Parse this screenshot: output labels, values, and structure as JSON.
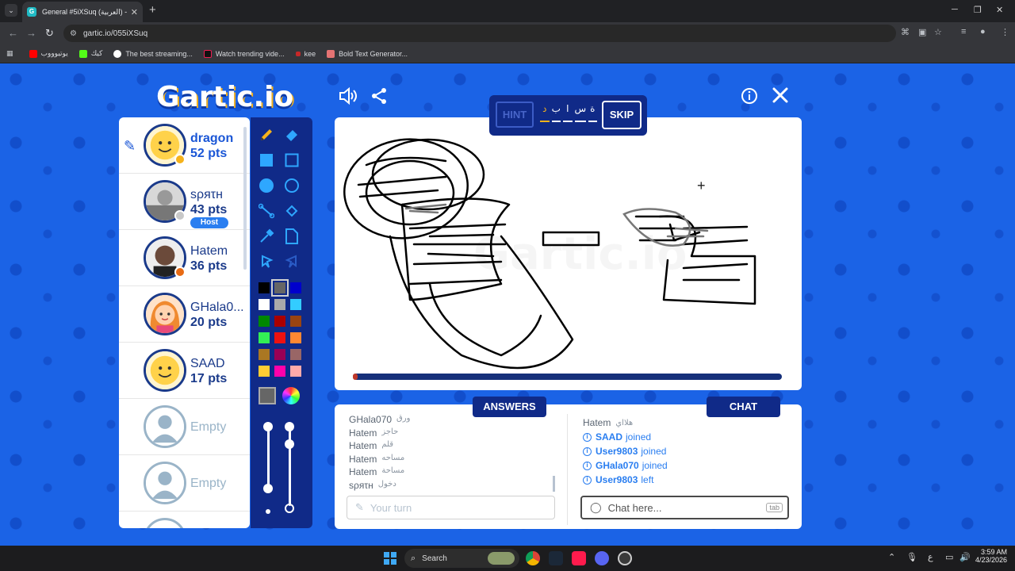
{
  "browser": {
    "tab_title": "General #5iXSuq (العربية) - Gartic",
    "url": "gartic.io/055iXSuq",
    "bookmarks": [
      "يوتيوووب",
      "كيك",
      "The best streaming...",
      "Watch trending vide...",
      "kee",
      "Bold Text Generator..."
    ]
  },
  "game": {
    "logo": "Gartic.io",
    "players": [
      {
        "name": "dragon",
        "pts": "52 pts",
        "badge": "",
        "status_color": "#f5b21b"
      },
      {
        "name": "ѕρяτн",
        "pts": "43 pts",
        "badge": "Host",
        "status_color": "#c8c8c8"
      },
      {
        "name": "Hatem",
        "pts": "36 pts",
        "badge": "",
        "status_color": "#e86b14"
      },
      {
        "name": "GHala0...",
        "pts": "20 pts",
        "badge": "",
        "status_color": ""
      },
      {
        "name": "SAAD",
        "pts": "17 pts",
        "badge": "",
        "status_color": ""
      },
      {
        "name": "Empty",
        "pts": "",
        "badge": "",
        "status_color": ""
      },
      {
        "name": "Empty",
        "pts": "",
        "badge": "",
        "status_color": ""
      }
    ],
    "hint_label": "HINT",
    "skip_label": "SKIP",
    "word_letters": [
      "د",
      "ب",
      "ا",
      "س",
      "ة"
    ],
    "round_progress": 0.01,
    "answers_tab": "ANSWERS",
    "chat_tab": "CHAT",
    "answers": [
      {
        "user": "GHala070",
        "word": "ورق"
      },
      {
        "user": "Hatem",
        "word": "حاجز"
      },
      {
        "user": "Hatem",
        "word": "قلم"
      },
      {
        "user": "Hatem",
        "word": "مساحه"
      },
      {
        "user": "Hatem",
        "word": "مساحة"
      },
      {
        "user": "ѕρяτн",
        "word": "دخول"
      }
    ],
    "chat": [
      {
        "type": "msg",
        "user": "Hatem",
        "text": "هلااي"
      },
      {
        "type": "sys",
        "user": "SAAD",
        "text": "joined"
      },
      {
        "type": "sys",
        "user": "User9803",
        "text": "joined"
      },
      {
        "type": "sys",
        "user": "GHala070",
        "text": "joined"
      },
      {
        "type": "sys",
        "user": "User9803",
        "text": "left"
      }
    ],
    "answer_placeholder": "Your turn",
    "chat_placeholder": "Chat here...",
    "tab_hint": "tab"
  },
  "taskbar": {
    "search_label": "Search",
    "time": "3:59 AM",
    "date": "4/23/2026",
    "lang": "ع"
  },
  "colors": {
    "game_bg": "#1b63e6",
    "panel_dark": "#102a88",
    "player_blue": "#1a56d6",
    "palette": [
      "#000000",
      "#666666",
      "#0000cc",
      "#ffffff",
      "#aaaaaa",
      "#33ccff",
      "#008800",
      "#aa0000",
      "#994411",
      "#33ee55",
      "#ee1111",
      "#ff8833",
      "#aa7722",
      "#990055",
      "#996666",
      "#ffcc33",
      "#ff00aa",
      "#ffaaaa"
    ]
  }
}
